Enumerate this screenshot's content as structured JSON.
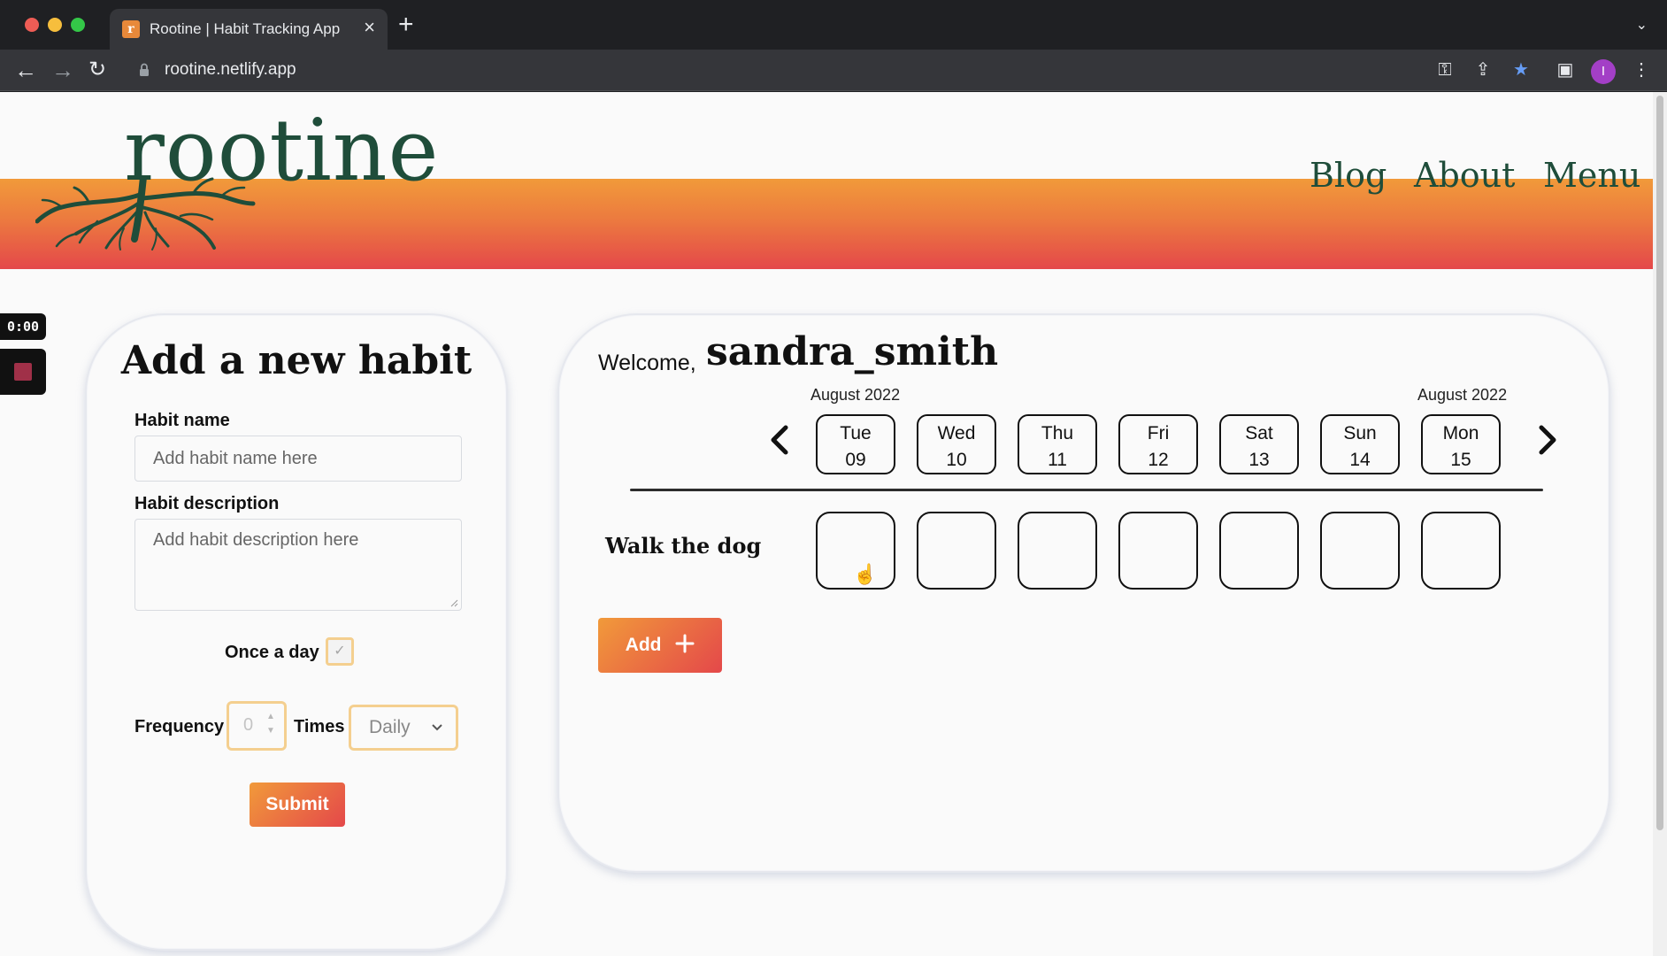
{
  "browser": {
    "tab_title": "Rootine | Habit Tracking App",
    "favicon_letter": "r",
    "url": "rootine.netlify.app",
    "profile_initial": "I"
  },
  "header": {
    "logo": "rootine",
    "nav": [
      "Blog",
      "About",
      "Menu"
    ],
    "colors": {
      "gradient_top": "#f19a3a",
      "gradient_bottom": "#e4484a",
      "brand_green": "#1f4d3a"
    }
  },
  "recorder": {
    "time": "0:00"
  },
  "form": {
    "title": "Add a new habit",
    "name_label": "Habit name",
    "name_placeholder": "Add habit name here",
    "description_label": "Habit description",
    "description_placeholder": "Add habit description here",
    "once_a_day_label": "Once a day",
    "once_a_day_checked": true,
    "frequency_label": "Frequency",
    "frequency_value": "0",
    "times_label": "Times",
    "period_value": "Daily",
    "submit_label": "Submit"
  },
  "tracker": {
    "welcome_label": "Welcome,",
    "username": "sandra_smith",
    "month_left": "August 2022",
    "month_right": "August 2022",
    "days": [
      {
        "dow": "Tue",
        "date": "09"
      },
      {
        "dow": "Wed",
        "date": "10"
      },
      {
        "dow": "Thu",
        "date": "11"
      },
      {
        "dow": "Fri",
        "date": "12"
      },
      {
        "dow": "Sat",
        "date": "13"
      },
      {
        "dow": "Sun",
        "date": "14"
      },
      {
        "dow": "Mon",
        "date": "15"
      }
    ],
    "habits": [
      {
        "name": "Walk the dog"
      }
    ],
    "add_label": "Add"
  }
}
